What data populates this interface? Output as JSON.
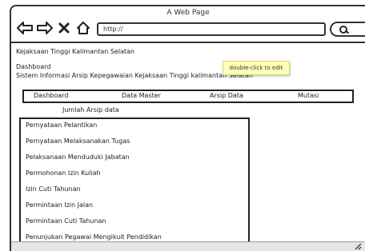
{
  "window": {
    "title": "A Web Page"
  },
  "toolbar": {
    "url": "http://",
    "icons": [
      "back-arrow-icon",
      "forward-arrow-icon",
      "close-x-icon",
      "home-icon",
      "search-icon"
    ]
  },
  "page": {
    "org_title": "Kejaksaan Tinggi Kalimantan Selatan",
    "breadcrumb": "Dashboard",
    "system_title": "Sistem Informasi Arsip Kepegawaian Kejaksaan Tinggi kalimantan Selatan",
    "tooltip": "double-click to edit",
    "menu": [
      "Dashboard",
      "Data Master",
      "Arsip Data",
      "Mutasi"
    ],
    "list_heading": "Jumlah Arsip data",
    "list_items": [
      "Pernyataan Pelantikan",
      "Pernyataan Melaksanakan Tugas",
      "Pelaksanaan Menduduki Jabatan",
      "Permohonan Izin Kuliah",
      "Izin Cuti Tahunan",
      "Permintaan Izin Jalan",
      "Permintaan Cuti Tahunan",
      "Penunjukan Pegawai Mengikuit Pendidikan"
    ]
  }
}
